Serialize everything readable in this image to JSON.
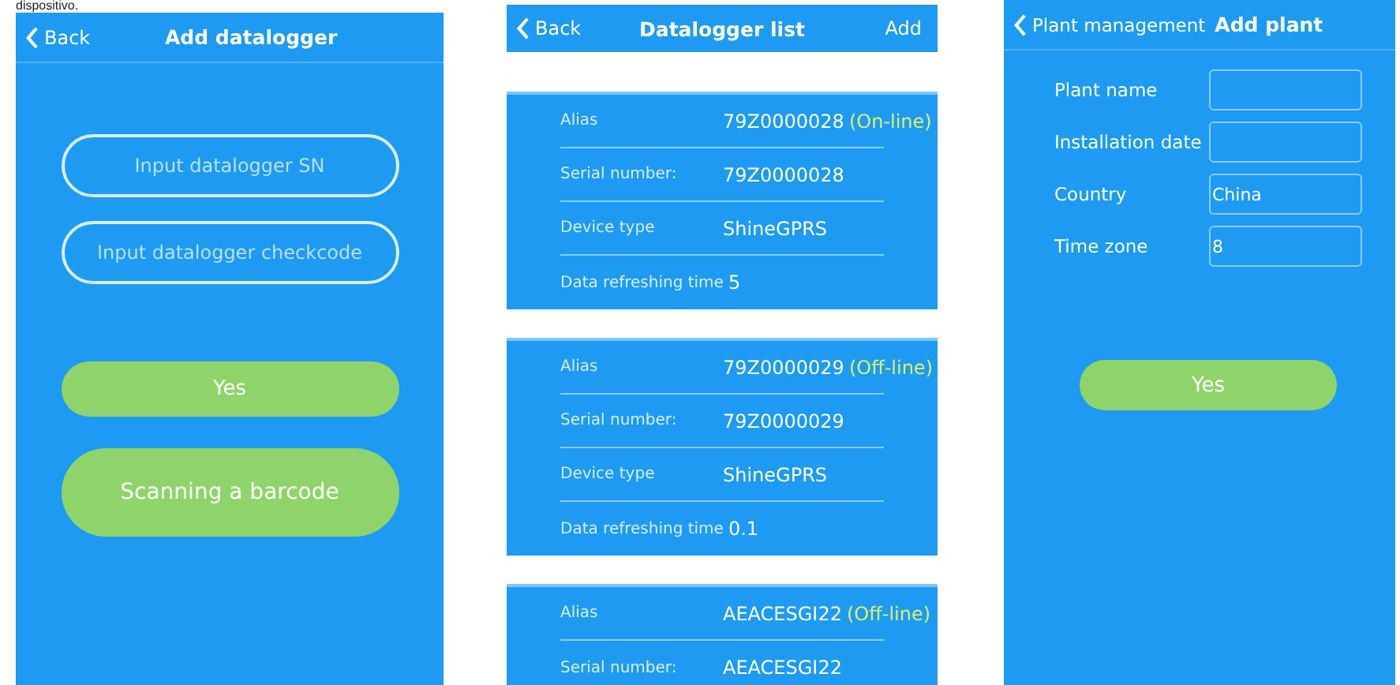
{
  "caption": "dispositivo.",
  "add_datalogger": {
    "back": "Back",
    "title": "Add datalogger",
    "fields": [
      {
        "placeholder": "Input datalogger SN"
      },
      {
        "placeholder": "Input datalogger checkcode"
      }
    ],
    "buttons": [
      {
        "label": "Yes",
        "kind": "small"
      },
      {
        "label": "Scanning a barcode",
        "kind": "large"
      }
    ]
  },
  "datalogger_list": {
    "back": "Back",
    "title": "Datalogger list",
    "action": "Add",
    "cards": [
      {
        "rows": [
          {
            "label": "Alias",
            "value": "79Z0000028",
            "status": "(On-line)"
          },
          {
            "label": "Serial number:",
            "value": "79Z0000028"
          },
          {
            "label": "Device type",
            "value": "ShineGPRS"
          },
          {
            "label": "Data refreshing time",
            "value": "5"
          }
        ]
      },
      {
        "rows": [
          {
            "label": "Alias",
            "value": "79Z0000029",
            "status": "(Off-line)"
          },
          {
            "label": "Serial number:",
            "value": "79Z0000029"
          },
          {
            "label": "Device type",
            "value": "ShineGPRS"
          },
          {
            "label": "Data refreshing time",
            "value": "0.1"
          }
        ]
      },
      {
        "rows": [
          {
            "label": "Alias",
            "value": "AEACESGI22",
            "status": "(Off-line)"
          },
          {
            "label": "Serial number:",
            "value": "AEACESGI22"
          }
        ]
      }
    ]
  },
  "add_plant": {
    "back": "Plant management",
    "title": "Add plant",
    "fields": [
      {
        "label": "Plant name"
      },
      {
        "label": "Installation date"
      },
      {
        "label": "Country",
        "value": "China"
      },
      {
        "label": "Time zone",
        "value": "8"
      }
    ],
    "button": "Yes"
  }
}
